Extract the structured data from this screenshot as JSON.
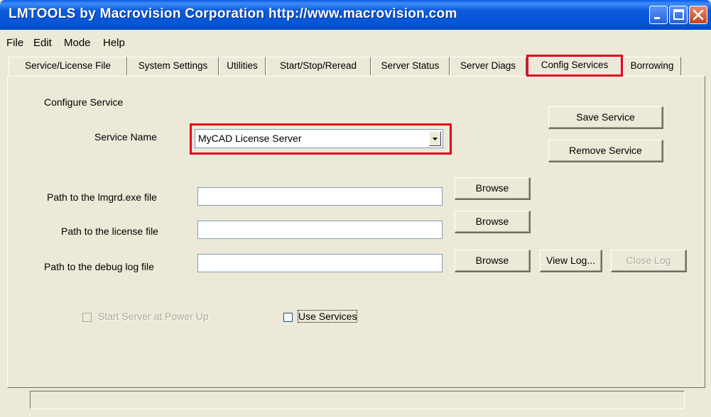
{
  "window": {
    "title": "LMTOOLS by Macrovision Corporation http://www.macrovision.com"
  },
  "menu": [
    "File",
    "Edit",
    "Mode",
    "Help"
  ],
  "tabs": [
    {
      "label": "Service/License File"
    },
    {
      "label": "System Settings"
    },
    {
      "label": "Utilities"
    },
    {
      "label": "Start/Stop/Reread"
    },
    {
      "label": "Server Status"
    },
    {
      "label": "Server Diags"
    },
    {
      "label": "Config Services",
      "active": true
    },
    {
      "label": "Borrowing"
    }
  ],
  "config": {
    "section_label": "Configure Service",
    "service_name_label": "Service Name",
    "service_name_value": "MyCAD License Server",
    "save_button": "Save Service",
    "remove_button": "Remove Service",
    "lmgrd_label": "Path to the lmgrd.exe file",
    "lmgrd_value": "",
    "license_label": "Path to the license file",
    "license_value": "",
    "debug_label": "Path to the debug log file",
    "debug_value": "",
    "browse_label": "Browse",
    "view_log_label": "View Log...",
    "close_log_label": "Close Log",
    "start_server_label": "Start Server at Power Up",
    "start_server_checked": false,
    "use_services_label": "Use Services",
    "use_services_checked": false
  },
  "status": {
    "text": ""
  },
  "colors": {
    "highlight_box": "#e3001b",
    "title_bar": "#0b5bdc"
  }
}
